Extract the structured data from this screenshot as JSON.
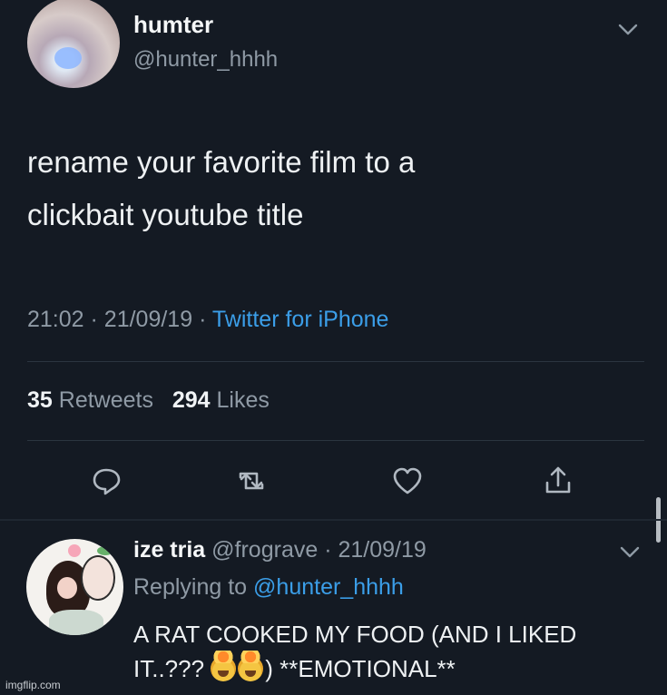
{
  "tweet": {
    "display_name": "humter",
    "handle": "@hunter_hhhh",
    "text_lines": [
      "rename your favorite film to a",
      "clickbait youtube title"
    ],
    "time": "21:02",
    "date": "21/09/19",
    "source": "Twitter for iPhone",
    "separator": "·",
    "retweet_count": "35",
    "retweet_label": "Retweets",
    "like_count": "294",
    "like_label": "Likes"
  },
  "actions": [
    "reply-icon",
    "retweet-icon",
    "like-icon",
    "share-icon"
  ],
  "reply": {
    "display_name": "ize tria",
    "handle": "@frograve",
    "separator": "·",
    "date": "21/09/19",
    "replying_label": "Replying to",
    "replying_handle": "@hunter_hhhh",
    "text_line1": "A RAT COOKED MY FOOD (AND I LIKED",
    "text_line2_a": "IT..???",
    "text_line2_b": ") **EMOTIONAL**",
    "emoji": [
      "exploding-head-emoji",
      "exploding-head-emoji"
    ]
  },
  "watermark": "imgflip.com",
  "colors": {
    "background": "#141a23",
    "link": "#3b9ee8",
    "secondary_text": "#8f9aa5"
  }
}
